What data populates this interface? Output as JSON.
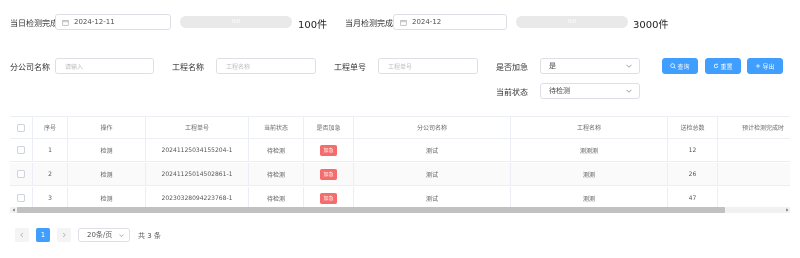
{
  "summary": {
    "today_label": "当日检测完成",
    "today_date": "2024-12-11",
    "today_progress_text": "0/0",
    "today_progress": 0,
    "today_count": "100件",
    "month_label": "当月检测完成",
    "month_date": "2024-12",
    "month_progress_text": "0/0",
    "month_progress": 0,
    "month_count": "3000件"
  },
  "filters": {
    "branch_label": "分公司名称",
    "branch_placeholder": "请输入",
    "project_label": "工程名称",
    "project_placeholder": "工程名称",
    "order_label": "工程单号",
    "order_placeholder": "工程单号",
    "urgent_label": "是否加急",
    "urgent_value": "是",
    "status_label": "当前状态",
    "status_value": "待检测"
  },
  "buttons": {
    "query": "查询",
    "reset": "重置",
    "export": "导出"
  },
  "table": {
    "columns": [
      "序号",
      "操作",
      "工程单号",
      "当前状态",
      "是否加急",
      "分公司名称",
      "工程名称",
      "送检总数",
      "预计检测完成时"
    ],
    "rows": [
      {
        "index": "1",
        "action": "检测",
        "order": "20241125034155204-1",
        "status": "待检测",
        "urgent": "加急",
        "branch": "测试",
        "project": "测测测",
        "total": "12"
      },
      {
        "index": "2",
        "action": "检测",
        "order": "20241125014502861-1",
        "status": "待检测",
        "urgent": "加急",
        "branch": "测试",
        "project": "测测",
        "total": "26"
      },
      {
        "index": "3",
        "action": "检测",
        "order": "20230328094223768-1",
        "status": "待检测",
        "urgent": "加急",
        "branch": "测试",
        "project": "测测",
        "total": "47"
      }
    ]
  },
  "pagination": {
    "current_page": "1",
    "page_size": "20条/页",
    "total": "共 3 条"
  },
  "colors": {
    "primary": "#409eff",
    "danger": "#f56c6c"
  }
}
